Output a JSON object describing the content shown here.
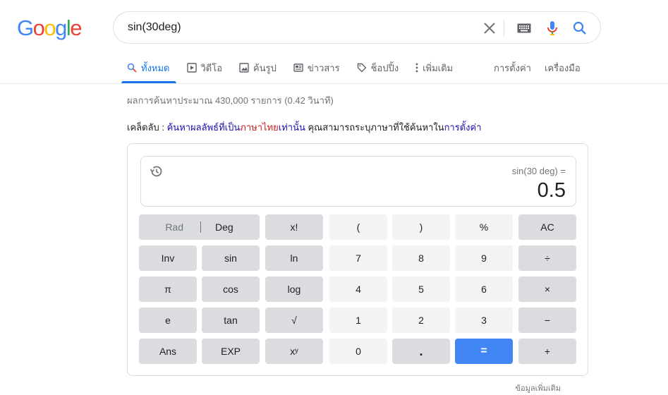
{
  "logo": {
    "letters": [
      {
        "ch": "G",
        "color": "#4285F4"
      },
      {
        "ch": "o",
        "color": "#EA4335"
      },
      {
        "ch": "o",
        "color": "#FBBC05"
      },
      {
        "ch": "g",
        "color": "#4285F4"
      },
      {
        "ch": "l",
        "color": "#34A853"
      },
      {
        "ch": "e",
        "color": "#EA4335"
      }
    ]
  },
  "search": {
    "query": "sin(30deg)",
    "icons": [
      "close-icon",
      "keyboard-icon",
      "microphone-icon",
      "search-icon"
    ]
  },
  "tabs": [
    {
      "label": "ทั้งหมด",
      "icon": "search-icon",
      "active": true
    },
    {
      "label": "วิดีโอ",
      "icon": "video-icon"
    },
    {
      "label": "ค้นรูป",
      "icon": "image-icon"
    },
    {
      "label": "ข่าวสาร",
      "icon": "news-icon"
    },
    {
      "label": "ช็อปปิ้ง",
      "icon": "tag-icon"
    },
    {
      "label": "เพิ่มเติม",
      "icon": "more-vert-icon"
    }
  ],
  "tools": {
    "settings": "การตั้งค่า",
    "tools": "เครื่องมือ"
  },
  "stats": "ผลการค้นหาประมาณ 430,000 รายการ (0.42 วินาที)",
  "tip": {
    "prefix": "เคล็ดลับ : ",
    "link1a": "ค้นหาผลลัพธ์ที่เป็น",
    "link1b": "ภาษาไทย",
    "link1c": "เท่านั้น",
    "middle": " คุณสามารถระบุภาษาที่ใช้ค้นหาใน",
    "link2": "การตั้งค่า"
  },
  "calculator": {
    "expression": "sin(30 deg) =",
    "result": "0.5",
    "mode": {
      "rad": "Rad",
      "deg": "Deg"
    },
    "keys": {
      "fact": "x!",
      "lparen": "(",
      "rparen": ")",
      "percent": "%",
      "clear": "AC",
      "inv": "Inv",
      "sin": "sin",
      "ln": "ln",
      "n7": "7",
      "n8": "8",
      "n9": "9",
      "divide": "÷",
      "pi": "π",
      "cos": "cos",
      "log": "log",
      "n4": "4",
      "n5": "5",
      "n6": "6",
      "multiply": "×",
      "e": "e",
      "tan": "tan",
      "sqrt": "√",
      "n1": "1",
      "n2": "2",
      "n3": "3",
      "minus": "−",
      "ans": "Ans",
      "exp": "EXP",
      "pow": "xʸ",
      "n0": "0",
      "dot": ".",
      "equals": "=",
      "plus": "+"
    },
    "equals_color": "#4285F4"
  },
  "more_info": "ข้อมูลเพิ่มเติม"
}
